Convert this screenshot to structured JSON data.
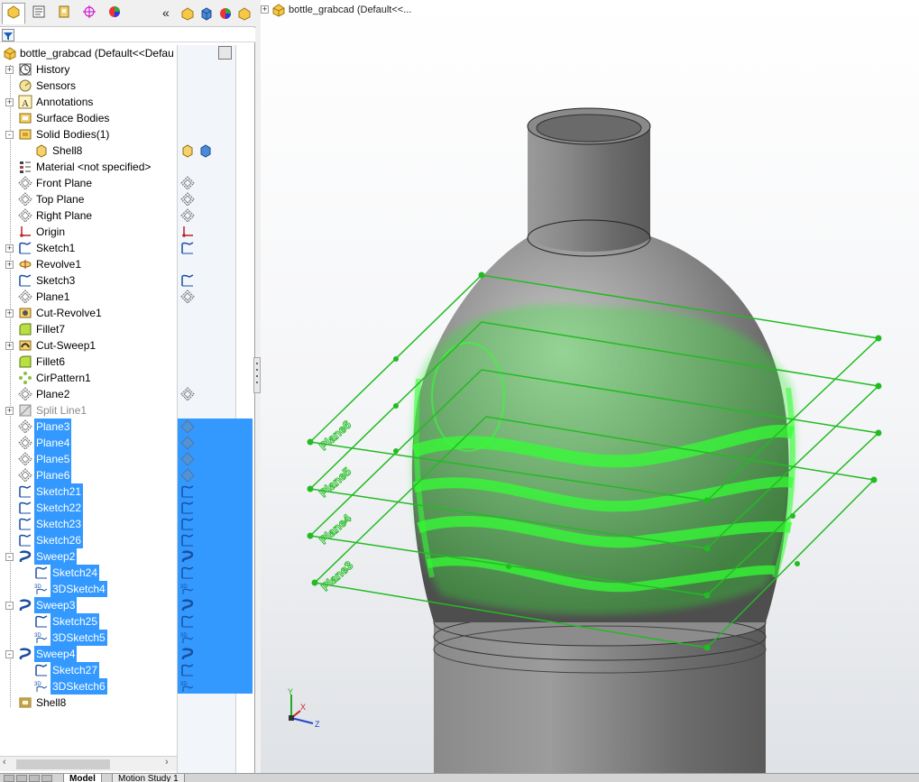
{
  "app": {
    "document_name": "bottle_grabcad",
    "root_label": "bottle_grabcad  (Default<<Defau",
    "flyout_label": "bottle_grabcad  (Default<<..."
  },
  "manager_tabs": [
    {
      "name": "featuremanager-tab",
      "icon": "feature-tree-icon",
      "active": true
    },
    {
      "name": "propertymanager-tab",
      "icon": "property-icon",
      "active": false
    },
    {
      "name": "configurationmanager-tab",
      "icon": "configuration-icon",
      "active": false
    },
    {
      "name": "dimxpert-tab",
      "icon": "dimxpert-icon",
      "active": false
    },
    {
      "name": "display-manager-tab",
      "icon": "appearance-icon",
      "active": false
    }
  ],
  "collapse_glyph": "«",
  "tree": [
    {
      "label": "History",
      "icon": "history-icon",
      "exp": "+",
      "indent": 0,
      "sel": false
    },
    {
      "label": "Sensors",
      "icon": "sensor-icon",
      "exp": "",
      "indent": 0,
      "sel": false
    },
    {
      "label": "Annotations",
      "icon": "annotation-icon",
      "exp": "+",
      "indent": 0,
      "sel": false
    },
    {
      "label": "Surface Bodies",
      "icon": "surface-bodies-icon",
      "exp": "",
      "indent": 0,
      "sel": false
    },
    {
      "label": "Solid Bodies(1)",
      "icon": "solid-bodies-icon",
      "exp": "-",
      "indent": 0,
      "sel": false
    },
    {
      "label": "Shell8",
      "icon": "body-icon",
      "exp": "",
      "indent": 1,
      "sel": false
    },
    {
      "label": "Material <not specified>",
      "icon": "material-icon",
      "exp": "",
      "indent": 0,
      "sel": false
    },
    {
      "label": "Front Plane",
      "icon": "plane-icon",
      "exp": "",
      "indent": 0,
      "sel": false
    },
    {
      "label": "Top Plane",
      "icon": "plane-icon",
      "exp": "",
      "indent": 0,
      "sel": false
    },
    {
      "label": "Right Plane",
      "icon": "plane-icon",
      "exp": "",
      "indent": 0,
      "sel": false
    },
    {
      "label": "Origin",
      "icon": "origin-icon",
      "exp": "",
      "indent": 0,
      "sel": false
    },
    {
      "label": "Sketch1",
      "icon": "sketch-icon",
      "exp": "+",
      "indent": 0,
      "sel": false
    },
    {
      "label": "Revolve1",
      "icon": "revolve-icon",
      "exp": "+",
      "indent": 0,
      "sel": false
    },
    {
      "label": "Sketch3",
      "icon": "sketch-icon",
      "exp": "",
      "indent": 0,
      "sel": false
    },
    {
      "label": "Plane1",
      "icon": "plane-icon",
      "exp": "",
      "indent": 0,
      "sel": false
    },
    {
      "label": "Cut-Revolve1",
      "icon": "cut-revolve-icon",
      "exp": "+",
      "indent": 0,
      "sel": false
    },
    {
      "label": "Fillet7",
      "icon": "fillet-icon",
      "exp": "",
      "indent": 0,
      "sel": false
    },
    {
      "label": "Cut-Sweep1",
      "icon": "cut-sweep-icon",
      "exp": "+",
      "indent": 0,
      "sel": false
    },
    {
      "label": "Fillet6",
      "icon": "fillet-icon",
      "exp": "",
      "indent": 0,
      "sel": false
    },
    {
      "label": "CirPattern1",
      "icon": "circular-pattern-icon",
      "exp": "",
      "indent": 0,
      "sel": false
    },
    {
      "label": "Plane2",
      "icon": "plane-icon",
      "exp": "",
      "indent": 0,
      "sel": false
    },
    {
      "label": "Split Line1",
      "icon": "split-line-icon",
      "exp": "+",
      "indent": 0,
      "sel": false,
      "dim": true
    },
    {
      "label": "Plane3",
      "icon": "plane-icon",
      "exp": "",
      "indent": 0,
      "sel": true
    },
    {
      "label": "Plane4",
      "icon": "plane-icon",
      "exp": "",
      "indent": 0,
      "sel": true
    },
    {
      "label": "Plane5",
      "icon": "plane-icon",
      "exp": "",
      "indent": 0,
      "sel": true
    },
    {
      "label": "Plane6",
      "icon": "plane-icon",
      "exp": "",
      "indent": 0,
      "sel": true
    },
    {
      "label": "Sketch21",
      "icon": "sketch-icon",
      "exp": "",
      "indent": 0,
      "sel": true
    },
    {
      "label": "Sketch22",
      "icon": "sketch-icon",
      "exp": "",
      "indent": 0,
      "sel": true
    },
    {
      "label": "Sketch23",
      "icon": "sketch-icon",
      "exp": "",
      "indent": 0,
      "sel": true
    },
    {
      "label": "Sketch26",
      "icon": "sketch-icon",
      "exp": "",
      "indent": 0,
      "sel": true
    },
    {
      "label": "Sweep2",
      "icon": "sweep-icon",
      "exp": "-",
      "indent": 0,
      "sel": true
    },
    {
      "label": "Sketch24",
      "icon": "sketch-icon",
      "exp": "",
      "indent": 1,
      "sel": true
    },
    {
      "label": "3DSketch4",
      "icon": "3dsketch-icon",
      "exp": "",
      "indent": 1,
      "sel": true
    },
    {
      "label": "Sweep3",
      "icon": "sweep-icon",
      "exp": "-",
      "indent": 0,
      "sel": true
    },
    {
      "label": "Sketch25",
      "icon": "sketch-icon",
      "exp": "",
      "indent": 1,
      "sel": true
    },
    {
      "label": "3DSketch5",
      "icon": "3dsketch-icon",
      "exp": "",
      "indent": 1,
      "sel": true
    },
    {
      "label": "Sweep4",
      "icon": "sweep-icon",
      "exp": "-",
      "indent": 0,
      "sel": true
    },
    {
      "label": "Sketch27",
      "icon": "sketch-icon",
      "exp": "",
      "indent": 1,
      "sel": true
    },
    {
      "label": "3DSketch6",
      "icon": "3dsketch-icon",
      "exp": "",
      "indent": 1,
      "sel": true
    },
    {
      "label": "Shell8",
      "icon": "shell-icon",
      "exp": "",
      "indent": 0,
      "sel": false
    }
  ],
  "plane_labels": [
    "Plane6",
    "Plane5",
    "Plane4",
    "Plane3"
  ],
  "bottom_tabs": [
    {
      "label": "Model",
      "active": true
    },
    {
      "label": "Motion Study 1",
      "active": false
    }
  ],
  "triad": {
    "y": "Y",
    "x": "X",
    "z": "Z"
  },
  "colors": {
    "selection": "#3399ff",
    "highlight_green": "#33dd33",
    "plane_green": "#22bb22",
    "body_gray": "#7a7a7a"
  }
}
